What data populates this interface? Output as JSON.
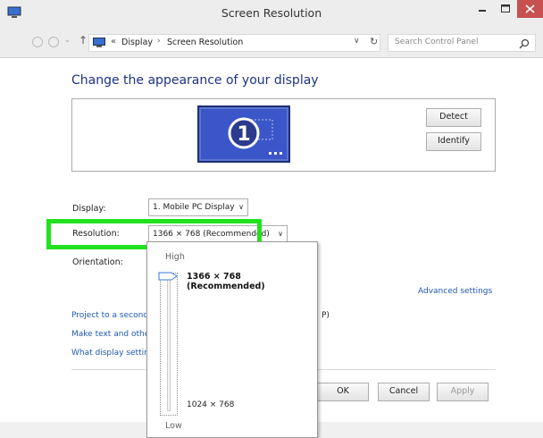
{
  "window": {
    "title": "Screen Resolution",
    "close_color": "#c75050"
  },
  "addressbar": {
    "breadcrumb_prefix": "«",
    "crumbs": [
      "Display",
      "Screen Resolution"
    ],
    "separator": "›",
    "search_placeholder": "Search Control Panel"
  },
  "main": {
    "heading": "Change the appearance of your display",
    "monitor_number": "1",
    "detect_label": "Detect",
    "identify_label": "Identify",
    "display_label": "Display:",
    "display_value": "1. Mobile PC Display",
    "resolution_label": "Resolution:",
    "resolution_value": "1366 × 768 (Recommended)",
    "orientation_label": "Orientation:",
    "advanced_link": "Advanced settings",
    "links": [
      "Project to a second",
      "Make text and other",
      "What display setting"
    ],
    "link_tail_text": "P)",
    "ok_label": "OK",
    "cancel_label": "Cancel",
    "apply_label": "Apply"
  },
  "resolution_popup": {
    "high_label": "High",
    "low_label": "Low",
    "options": [
      "1366 × 768 (Recommended)",
      "1024 × 768"
    ],
    "selected_index": 0
  },
  "colors": {
    "heading": "#1e3287",
    "link": "#1d59b3",
    "highlight": "#21e21f",
    "monitor_screen": "#3a56c8"
  }
}
